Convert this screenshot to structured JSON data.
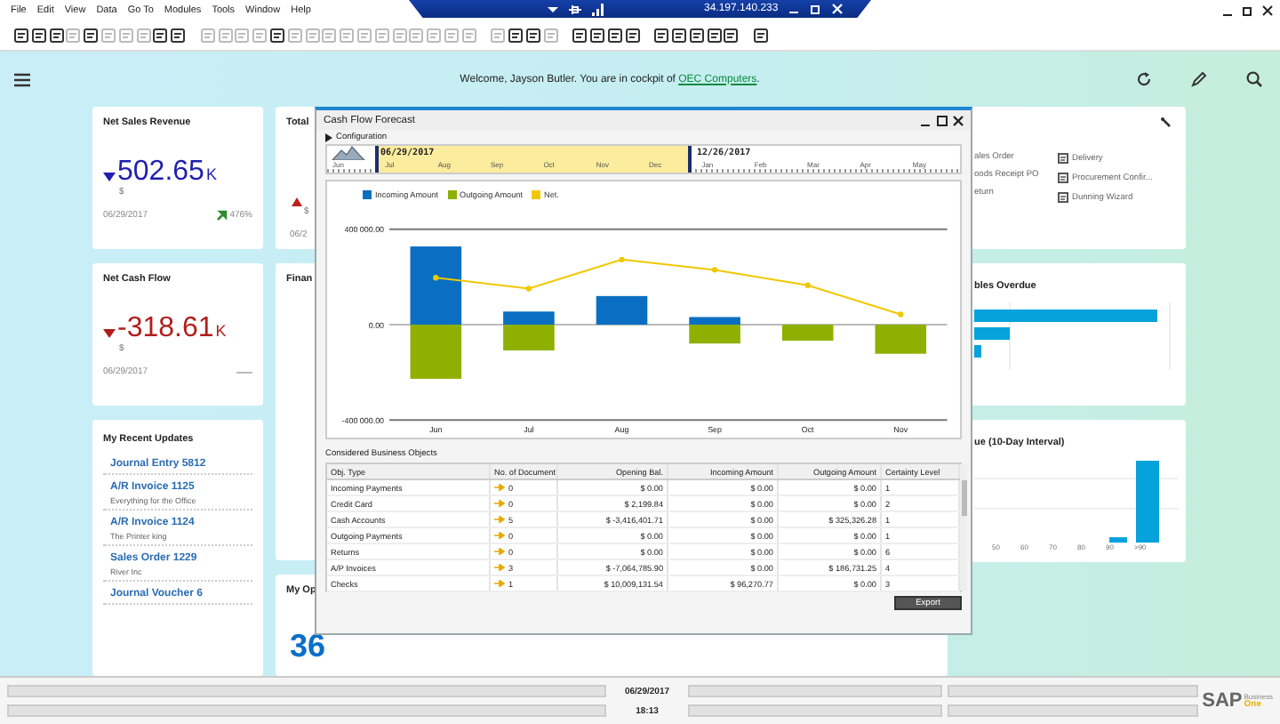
{
  "menu_bar": {
    "items": [
      "File",
      "Edit",
      "View",
      "Data",
      "Go To",
      "Modules",
      "Tools",
      "Window",
      "Help"
    ]
  },
  "remote_session": {
    "address": "34.197.140.233"
  },
  "header": {
    "welcome": "Welcome, Jayson Butler. You are in cockpit of ",
    "company": "OEC Computers",
    "end": "."
  },
  "kpi_cards": [
    {
      "title": "Net Sales Revenue",
      "value": "502.65",
      "suffix": "K",
      "unit": "$",
      "date": "06/29/2017",
      "color": "#1f1fb0",
      "change": "476%"
    },
    {
      "title": "Net Cash Flow",
      "value": "-318.61",
      "suffix": "K",
      "unit": "$",
      "date": "06/29/2017",
      "color": "#b21d1d"
    }
  ],
  "recent_updates": {
    "title": "My Recent Updates",
    "items": [
      {
        "title": "Journal Entry 5812"
      },
      {
        "title": "A/R Invoice 1125",
        "subtitle": "Everything for the Office"
      },
      {
        "title": "A/R Invoice 1124",
        "subtitle": "The Printer king"
      },
      {
        "title": "Sales Order 1229",
        "subtitle": "River Inc"
      },
      {
        "title": "Journal Voucher 6"
      }
    ]
  },
  "partial_cards": [
    {
      "kind": "kpi",
      "title": "Total",
      "unit": "$",
      "date": "06/2"
    },
    {
      "kind": "plain",
      "title": "Finan"
    },
    {
      "kind": "count",
      "title": "My Op",
      "value": "36"
    }
  ],
  "dialog": {
    "title": "Cash Flow Forecast",
    "configuration": "Configuration",
    "timeline": {
      "start": "06/29/2017",
      "end": "12/26/2017",
      "months": [
        "Jun",
        "Jul",
        "Aug",
        "Sep",
        "Oct",
        "Nov",
        "Dec",
        "Jan",
        "Feb",
        "Mar",
        "Apr",
        "May"
      ]
    },
    "chart_data": {
      "type": "bar",
      "stacked": true,
      "categories": [
        "Jun",
        "Jul",
        "Aug",
        "Sep",
        "Oct",
        "Nov"
      ],
      "ylim": [
        -400000,
        400000
      ],
      "yticks": [
        {
          "value": -400000,
          "label": "-400 000.00"
        },
        {
          "value": 0,
          "label": "0.00"
        },
        {
          "value": 400000,
          "label": "400 000.00"
        }
      ],
      "series": [
        {
          "name": "Incoming Amount",
          "color": "#0a6fc2",
          "type": "bar",
          "values": [
            328000,
            55000,
            120000,
            32000,
            0,
            0
          ]
        },
        {
          "name": "Outgoing Amount",
          "color": "#8fb000",
          "type": "bar",
          "values": [
            -227000,
            -108000,
            0,
            -79000,
            -67000,
            -122000
          ]
        },
        {
          "name": "Net.",
          "color": "#f0c800",
          "type": "line",
          "marker": "circle",
          "values": [
            197000,
            151000,
            273000,
            230000,
            165000,
            43000
          ]
        }
      ]
    },
    "section_title": "Considered Business Objects",
    "table": {
      "columns": [
        "Obj. Type",
        "No. of Document",
        "Opening Bal.",
        "Incoming Amount",
        "Outgoing Amount",
        "Certainty Level"
      ],
      "rows": [
        [
          "Incoming Payments",
          "0",
          "$ 0.00",
          "$ 0.00",
          "$ 0.00",
          "1"
        ],
        [
          "Credit Card",
          "0",
          "$ 2,199.84",
          "$ 0.00",
          "$ 0.00",
          "2"
        ],
        [
          "Cash Accounts",
          "5",
          "$ -3,416,401.71",
          "$ 0.00",
          "$ 325,326.28",
          "1"
        ],
        [
          "Outgoing Payments",
          "0",
          "$ 0.00",
          "$ 0.00",
          "$ 0.00",
          "1"
        ],
        [
          "Returns",
          "0",
          "$ 0.00",
          "$ 0.00",
          "$ 0.00",
          "6"
        ],
        [
          "A/P Invoices",
          "3",
          "$ -7,064,785.90",
          "$ 0.00",
          "$ 186,731.25",
          "4"
        ],
        [
          "Checks",
          "1",
          "$ 10,009,131.54",
          "$ 96,270.77",
          "$ 0.00",
          "3"
        ]
      ]
    },
    "export_button": "Export"
  },
  "shortcuts": {
    "column_1": [
      "ales Order",
      "oods Receipt PO",
      "eturn"
    ],
    "column_2": [
      "Delivery",
      "Procurement Confir...",
      "Dunning Wizard"
    ]
  },
  "overdue_card": {
    "title": "bles Overdue"
  },
  "aging_card": {
    "title": "ue (10-Day Interval)",
    "axis_labels": [
      "50",
      "60",
      "70",
      "80",
      "90",
      ">90"
    ]
  },
  "status_bar": {
    "date": "06/29/2017",
    "time": "18:13"
  },
  "logo": {
    "brand": "SAP",
    "product_1": "Business",
    "product_2": "One"
  }
}
